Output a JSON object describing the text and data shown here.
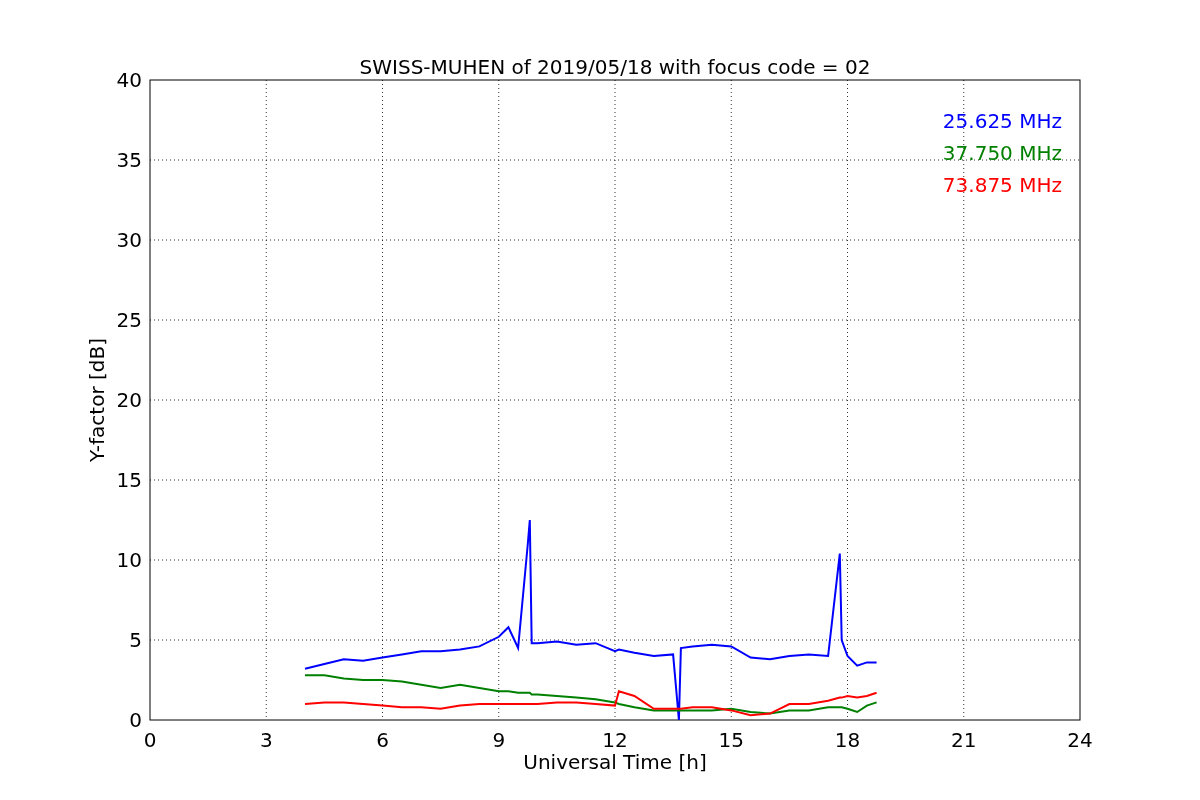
{
  "figure": {
    "chart_data": {
      "type": "line",
      "title": "SWISS-MUHEN of 2019/05/18 with focus code = 02",
      "xlabel": "Universal Time [h]",
      "ylabel": "Y-factor [dB]",
      "x": [
        4,
        4.5,
        5,
        5.5,
        6,
        6.5,
        7,
        7.5,
        8,
        8.5,
        9,
        9.25,
        9.5,
        9.75,
        9.8,
        9.85,
        10,
        10.5,
        11,
        11.5,
        12,
        12.1,
        12.5,
        13,
        13.5,
        13.65,
        13.7,
        14,
        14.5,
        15,
        15.5,
        16,
        16.5,
        17,
        17.5,
        17.8,
        17.85,
        18,
        18.25,
        18.5,
        18.75
      ],
      "series": [
        {
          "name": "25.625 MHz",
          "color": "#0000ff",
          "values": [
            3.2,
            3.5,
            3.8,
            3.7,
            3.9,
            4.1,
            4.3,
            4.3,
            4.4,
            4.6,
            5.2,
            5.8,
            4.5,
            11,
            12.5,
            4.8,
            4.8,
            4.9,
            4.7,
            4.8,
            4.3,
            4.4,
            4.2,
            4.0,
            4.1,
            0,
            4.5,
            4.6,
            4.7,
            4.6,
            3.9,
            3.8,
            4.0,
            4.1,
            4.0,
            10.4,
            5,
            4.0,
            3.4,
            3.6,
            3.6
          ]
        },
        {
          "name": "37.750 MHz",
          "color": "#008000",
          "values": [
            2.8,
            2.8,
            2.6,
            2.5,
            2.5,
            2.4,
            2.2,
            2.0,
            2.2,
            2.0,
            1.8,
            1.8,
            1.7,
            1.7,
            1.7,
            1.6,
            1.6,
            1.5,
            1.4,
            1.3,
            1.1,
            1.0,
            0.8,
            0.6,
            0.6,
            0.6,
            0.6,
            0.6,
            0.6,
            0.7,
            0.5,
            0.4,
            0.6,
            0.6,
            0.8,
            0.8,
            0.8,
            0.7,
            0.5,
            0.9,
            1.1
          ]
        },
        {
          "name": "73.875 MHz",
          "color": "#ff0000",
          "values": [
            1.0,
            1.1,
            1.1,
            1.0,
            0.9,
            0.8,
            0.8,
            0.7,
            0.9,
            1.0,
            1.0,
            1.0,
            1.0,
            1.0,
            1.0,
            1.0,
            1.0,
            1.1,
            1.1,
            1.0,
            0.9,
            1.8,
            1.5,
            0.7,
            0.7,
            0.7,
            0.7,
            0.8,
            0.8,
            0.6,
            0.3,
            0.4,
            1.0,
            1.0,
            1.2,
            1.4,
            1.4,
            1.5,
            1.4,
            1.5,
            1.7
          ]
        }
      ],
      "grid": true,
      "xlim": [
        0,
        24
      ],
      "ylim": [
        0,
        40
      ],
      "xticks": [
        0,
        3,
        6,
        9,
        12,
        15,
        18,
        21,
        24
      ],
      "yticks": [
        0,
        5,
        10,
        15,
        20,
        25,
        30,
        35,
        40
      ]
    }
  }
}
